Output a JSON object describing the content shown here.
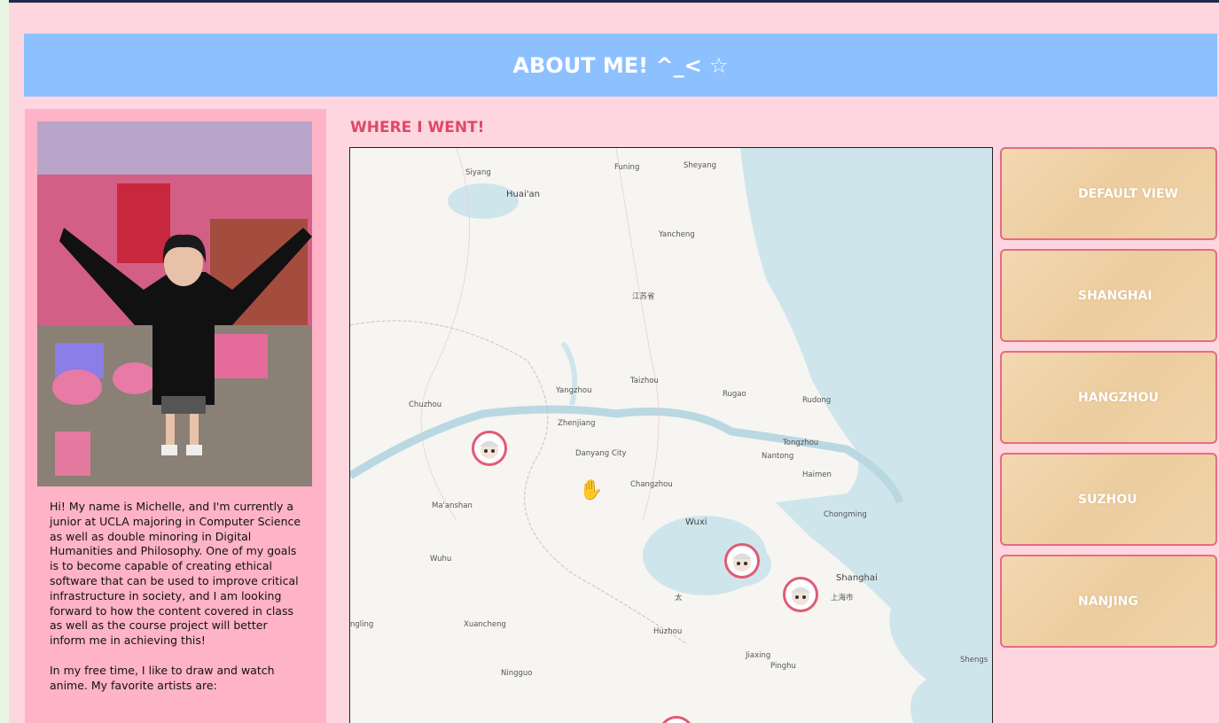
{
  "banner": {
    "title": "ABOUT ME! ^_< ☆"
  },
  "sidebar": {
    "bio_paragraph_1": "Hi! My name is Michelle, and I'm currently a junior at UCLA majoring in Computer Science as well as double minoring in Digital Humanities and Philosophy. One of my goals is to become capable of creating ethical software that can be used to improve critical infrastructure in society, and I am looking forward to how the content covered in class as well as the course project will better inform me in achieving this!",
    "bio_paragraph_2": "In my free time, I like to draw and watch anime. My favorite artists are:"
  },
  "map_section": {
    "heading": "WHERE I WENT!",
    "labels": [
      "Siyang",
      "Funing",
      "Sheyang",
      "Huai'an",
      "Yancheng",
      "江苏省",
      "Yangzhou",
      "Taizhou",
      "Rugao",
      "Rudong",
      "Chuzhou",
      "Zhenjiang",
      "Tongzhou",
      "Nantong",
      "Danyang City",
      "Haimen",
      "Changzhou",
      "Ma'anshan",
      "Wuxi",
      "Chongming",
      "Wuhu",
      "Shanghai",
      "上海市",
      "ngling",
      "Xuancheng",
      "Huzhou",
      "Jiaxing",
      "Pinghu",
      "Ningguo",
      "Shengs",
      "太"
    ]
  },
  "buttons": [
    {
      "label": "DEFAULT VIEW"
    },
    {
      "label": "SHANGHAI"
    },
    {
      "label": "HANGZHOU"
    },
    {
      "label": "SUZHOU"
    },
    {
      "label": "NANJING"
    }
  ],
  "colors": {
    "page_bg": "#fdd6e0",
    "banner_bg": "#8cc0ff",
    "sidebar_bg": "#feb3c6",
    "heading": "#e04866",
    "marker_border": "#e25a74",
    "ticket_border": "#e66c83"
  },
  "icons": {
    "cursor": "grab-hand-icon",
    "marker": "avatar-marker-icon"
  }
}
